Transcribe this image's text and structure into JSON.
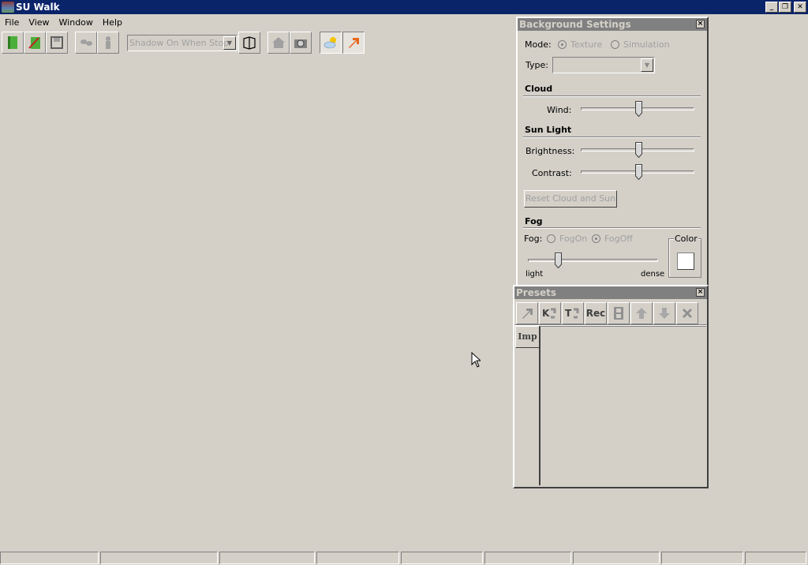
{
  "window": {
    "title": "SU Walk",
    "controls": [
      "minimize",
      "restore",
      "close"
    ]
  },
  "menu": [
    "File",
    "View",
    "Window",
    "Help"
  ],
  "toolbar": {
    "buttons": [
      {
        "name": "open-model",
        "icon": "green-book-icon"
      },
      {
        "name": "edit-model",
        "icon": "pencil-book-icon"
      },
      {
        "name": "save",
        "icon": "floppy-icon"
      },
      {
        "name": "walk",
        "icon": "footsteps-icon",
        "disabled": true
      },
      {
        "name": "person",
        "icon": "person-icon",
        "disabled": true
      },
      {
        "name": "section",
        "icon": "box-outline-icon"
      },
      {
        "name": "home-view",
        "icon": "house-icon",
        "disabled": true
      },
      {
        "name": "camera",
        "icon": "camera-icon"
      },
      {
        "name": "background",
        "icon": "sun-cloud-icon",
        "pressed": true
      },
      {
        "name": "presets",
        "icon": "orange-arrow-icon",
        "pressed": true
      }
    ],
    "shadow_combo": "Shadow On When Stop"
  },
  "background_settings": {
    "title": "Background Settings",
    "mode_label": "Mode:",
    "mode_options": [
      "Texture",
      "Simulation"
    ],
    "mode_selected": "Texture",
    "type_label": "Type:",
    "type_value": "",
    "cloud_header": "Cloud",
    "wind_label": "Wind:",
    "wind_value": 0.51,
    "sun_header": "Sun Light",
    "brightness_label": "Brightness:",
    "brightness_value": 0.51,
    "contrast_label": "Contrast:",
    "contrast_value": 0.51,
    "reset_button": "Reset Cloud and Sun",
    "fog_header": "Fog",
    "fog_label": "Fog:",
    "fog_options": [
      "FogOn",
      "FogOff"
    ],
    "fog_selected": "FogOff",
    "fog_density": 0.23,
    "fog_min_label": "light",
    "fog_max_label": "dense",
    "color_label": "Color",
    "fog_color": "#ffffff"
  },
  "presets": {
    "title": "Presets",
    "tools": [
      {
        "name": "go",
        "label": ""
      },
      {
        "name": "keyframe",
        "label": "K"
      },
      {
        "name": "transition",
        "label": "T"
      },
      {
        "name": "record",
        "label": "Rec"
      },
      {
        "name": "film",
        "label": ""
      },
      {
        "name": "up",
        "label": ""
      },
      {
        "name": "down",
        "label": ""
      },
      {
        "name": "delete",
        "label": ""
      }
    ],
    "import_button": "Imp"
  },
  "colors": {
    "titlebar": "#0a246a",
    "face": "#d4d0c8",
    "panel_title": "#808080",
    "accent_arrow": "#e8681a"
  }
}
